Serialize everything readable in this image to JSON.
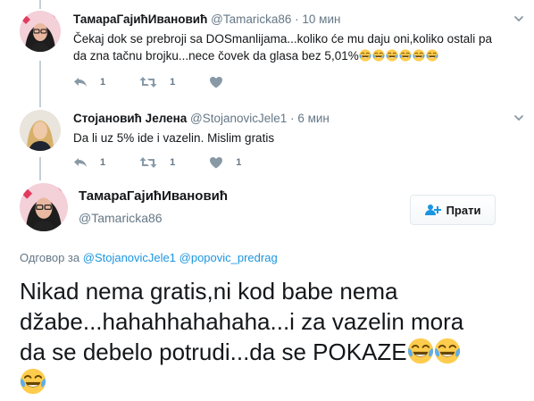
{
  "tweets": [
    {
      "display_name": "ТамараГајићИвановић",
      "handle": "@Tamaricka86",
      "separator": "·",
      "time": "10 мин",
      "text_line1": "Čekaj dok se prebroji sa DOSmanlijama...koliko će mu daju oni,koliko ostali pa",
      "text_line2": "da zna tačnu brojku...nece čovek da glasa bez 5,01%",
      "emoji_count": 6,
      "reply_count": "1",
      "retweet_count": "1",
      "like_count": ""
    },
    {
      "display_name": "Стојановић Јелена",
      "handle": "@StojanovicJele1",
      "separator": "·",
      "time": "6 мин",
      "text_line1": "Da li uz 5% ide i vazelin. Mislim gratis",
      "reply_count": "1",
      "retweet_count": "1",
      "like_count": "1"
    }
  ],
  "main_tweet": {
    "display_name": "ТамараГајићИвановић",
    "handle": "@Tamaricka86",
    "follow_label": "Прати",
    "reply_prefix": "Одговор за",
    "reply_mention_1": "@StojanovicJele1",
    "reply_mention_2": "@popovic_predrag",
    "text_line1": "Nikad nema gratis,ni kod babe nema",
    "text_line2": "džabe...hahahhahahaha...i za vazelin mora",
    "text_line3": "da se debelo potrudi...da se POKAZE"
  },
  "colors": {
    "link": "#1b95e0",
    "secondary_text": "#657786",
    "thread_line": "#c4cfd6",
    "emoji_face": "#ffcc4d"
  },
  "icons": [
    "reply-icon",
    "retweet-icon",
    "heart-icon",
    "chevron-down-icon",
    "follow-user-icon",
    "tears-of-joy-emoji"
  ]
}
